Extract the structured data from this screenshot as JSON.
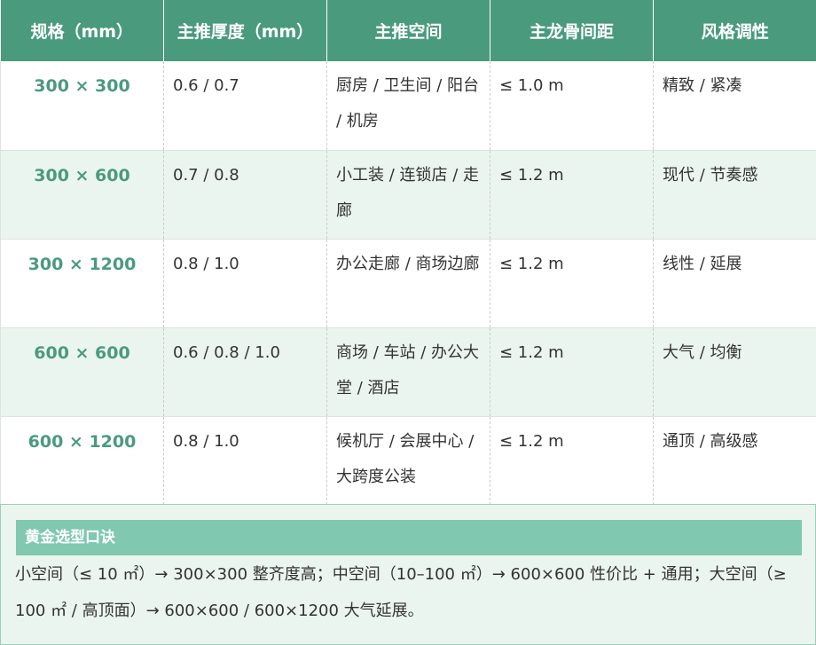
{
  "table": {
    "headers": [
      "规格（mm）",
      "主推厚度（mm）",
      "主推空间",
      "主龙骨间距",
      "风格调性"
    ],
    "rows": [
      {
        "size": "300 × 300",
        "thickness": "0.6 / 0.7",
        "space": "厨房 / 卫生间 / 阳台 / 机房",
        "spacing": "≤ 1.0 m",
        "style": "精致 / 紧凑"
      },
      {
        "size": "300 × 600",
        "thickness": "0.7 / 0.8",
        "space": "小工装 / 连锁店 / 走廊",
        "spacing": "≤ 1.2 m",
        "style": "现代 / 节奏感"
      },
      {
        "size": "300 × 1200",
        "thickness": "0.8 / 1.0",
        "space": "办公走廊 / 商场边廊",
        "spacing": "≤ 1.2 m",
        "style": "线性 / 延展"
      },
      {
        "size": "600 × 600",
        "thickness": "0.6 / 0.8 / 1.0",
        "space": "商场 / 车站 / 办公大堂 / 酒店",
        "spacing": "≤ 1.2 m",
        "style": "大气 / 均衡"
      },
      {
        "size": "600 × 1200",
        "thickness": "0.8 / 1.0",
        "space": "候机厅 / 会展中心 / 大跨度公装",
        "spacing": "≤ 1.2 m",
        "style": "通顶 / 高级感"
      }
    ]
  },
  "tip": {
    "title": "黄金选型口诀",
    "text": "小空间（≤ 10 ㎡）→ 300×300 整齐度高；中空间（10–100 ㎡）→ 600×600 性价比 + 通用；大空间（≥ 100 ㎡ / 高顶面）→ 600×600 / 600×1200 大气延展。"
  },
  "colors": {
    "header_bg": "#4a9a7e",
    "accent_text": "#4a9a7e",
    "alt_row_bg": "#ebf5ef",
    "tip_title_bg": "#80c8b0",
    "tip_border": "#9ccdb8"
  }
}
